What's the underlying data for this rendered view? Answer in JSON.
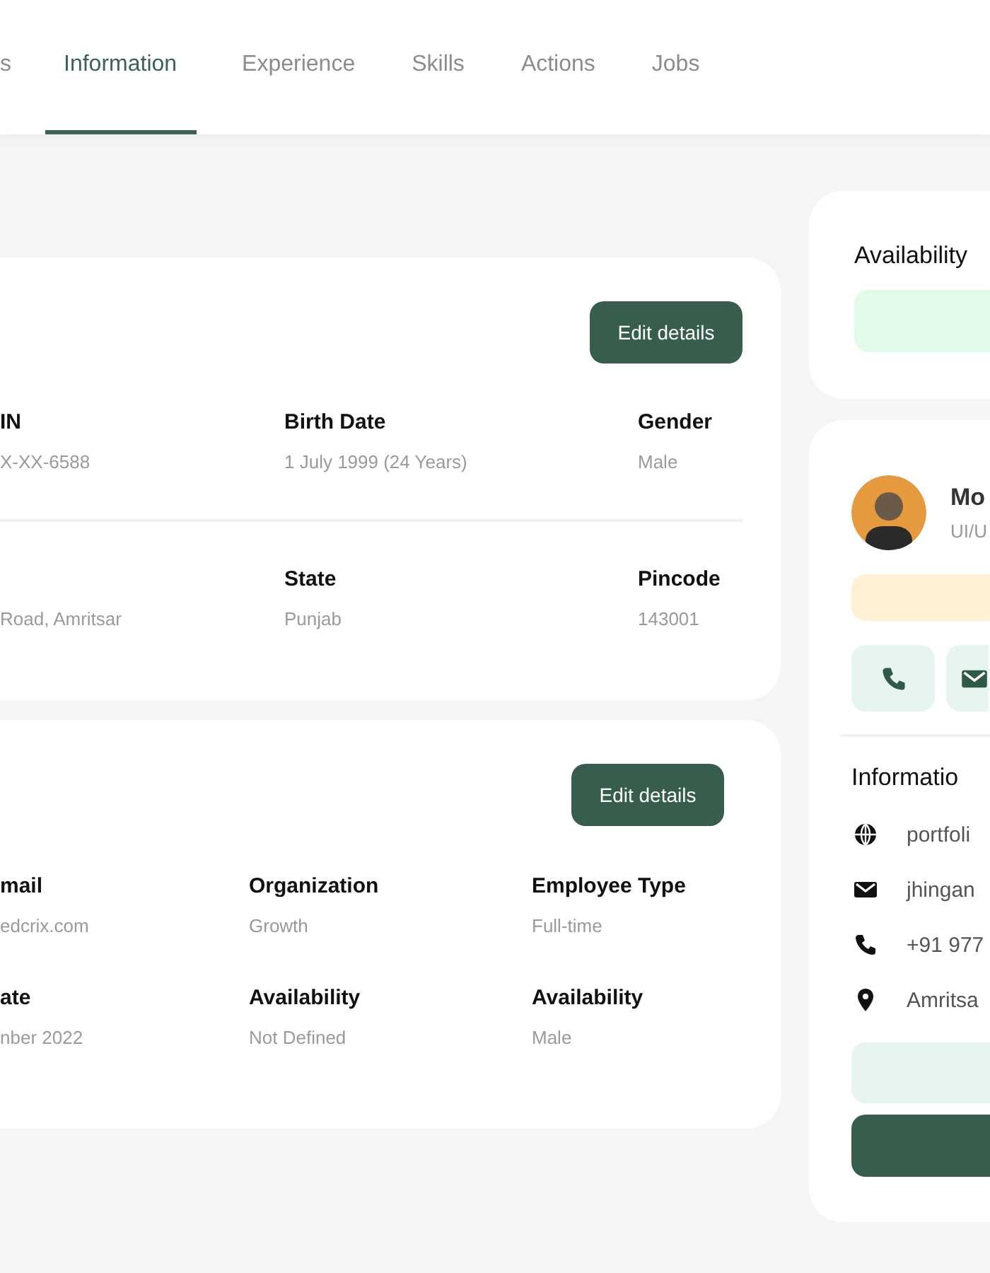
{
  "tabs": [
    {
      "label": "s",
      "selected": false
    },
    {
      "label": "Information",
      "selected": true
    },
    {
      "label": "Experience",
      "selected": false
    },
    {
      "label": "Skills",
      "selected": false
    },
    {
      "label": "Actions",
      "selected": false
    },
    {
      "label": "Jobs",
      "selected": false
    }
  ],
  "cards": [
    {
      "button": "Edit details",
      "divider": true,
      "rows": [
        [
          {
            "label": "IN",
            "value": "X-XX-6588"
          },
          {
            "label": "Birth Date",
            "value": "1 July 1999 (24 Years)"
          },
          {
            "label": "Gender",
            "value": "Male"
          }
        ],
        [
          {
            "value": "Road, Amritsar"
          },
          {
            "label": "State",
            "value": "Punjab"
          },
          {
            "label": "Pincode",
            "value": "143001"
          }
        ]
      ]
    },
    {
      "button": "Edit details",
      "divider": false,
      "rows": [
        [
          {
            "label": "mail",
            "value": "edcrix.com"
          },
          {
            "label": "Organization",
            "value": "Growth"
          },
          {
            "label": "Employee Type",
            "value": "Full-time"
          }
        ],
        [
          {
            "label": "ate",
            "value": "nber 2022"
          },
          {
            "label": "Availability",
            "value": "Not Defined"
          },
          {
            "label": "Availability",
            "value": "Male"
          }
        ]
      ]
    }
  ],
  "availability": {
    "title": "Availability"
  },
  "profile": {
    "name": "Mo",
    "role": "UI/U",
    "contact_buttons": [
      {
        "kind": "phone"
      },
      {
        "kind": "mail"
      }
    ],
    "info_title": "Informatio",
    "info": [
      {
        "kind": "web",
        "text": "portfoli"
      },
      {
        "kind": "mail",
        "text": "jhingan"
      },
      {
        "kind": "phone",
        "text": "+91 977"
      },
      {
        "kind": "location",
        "text": "Amritsa"
      }
    ]
  }
}
